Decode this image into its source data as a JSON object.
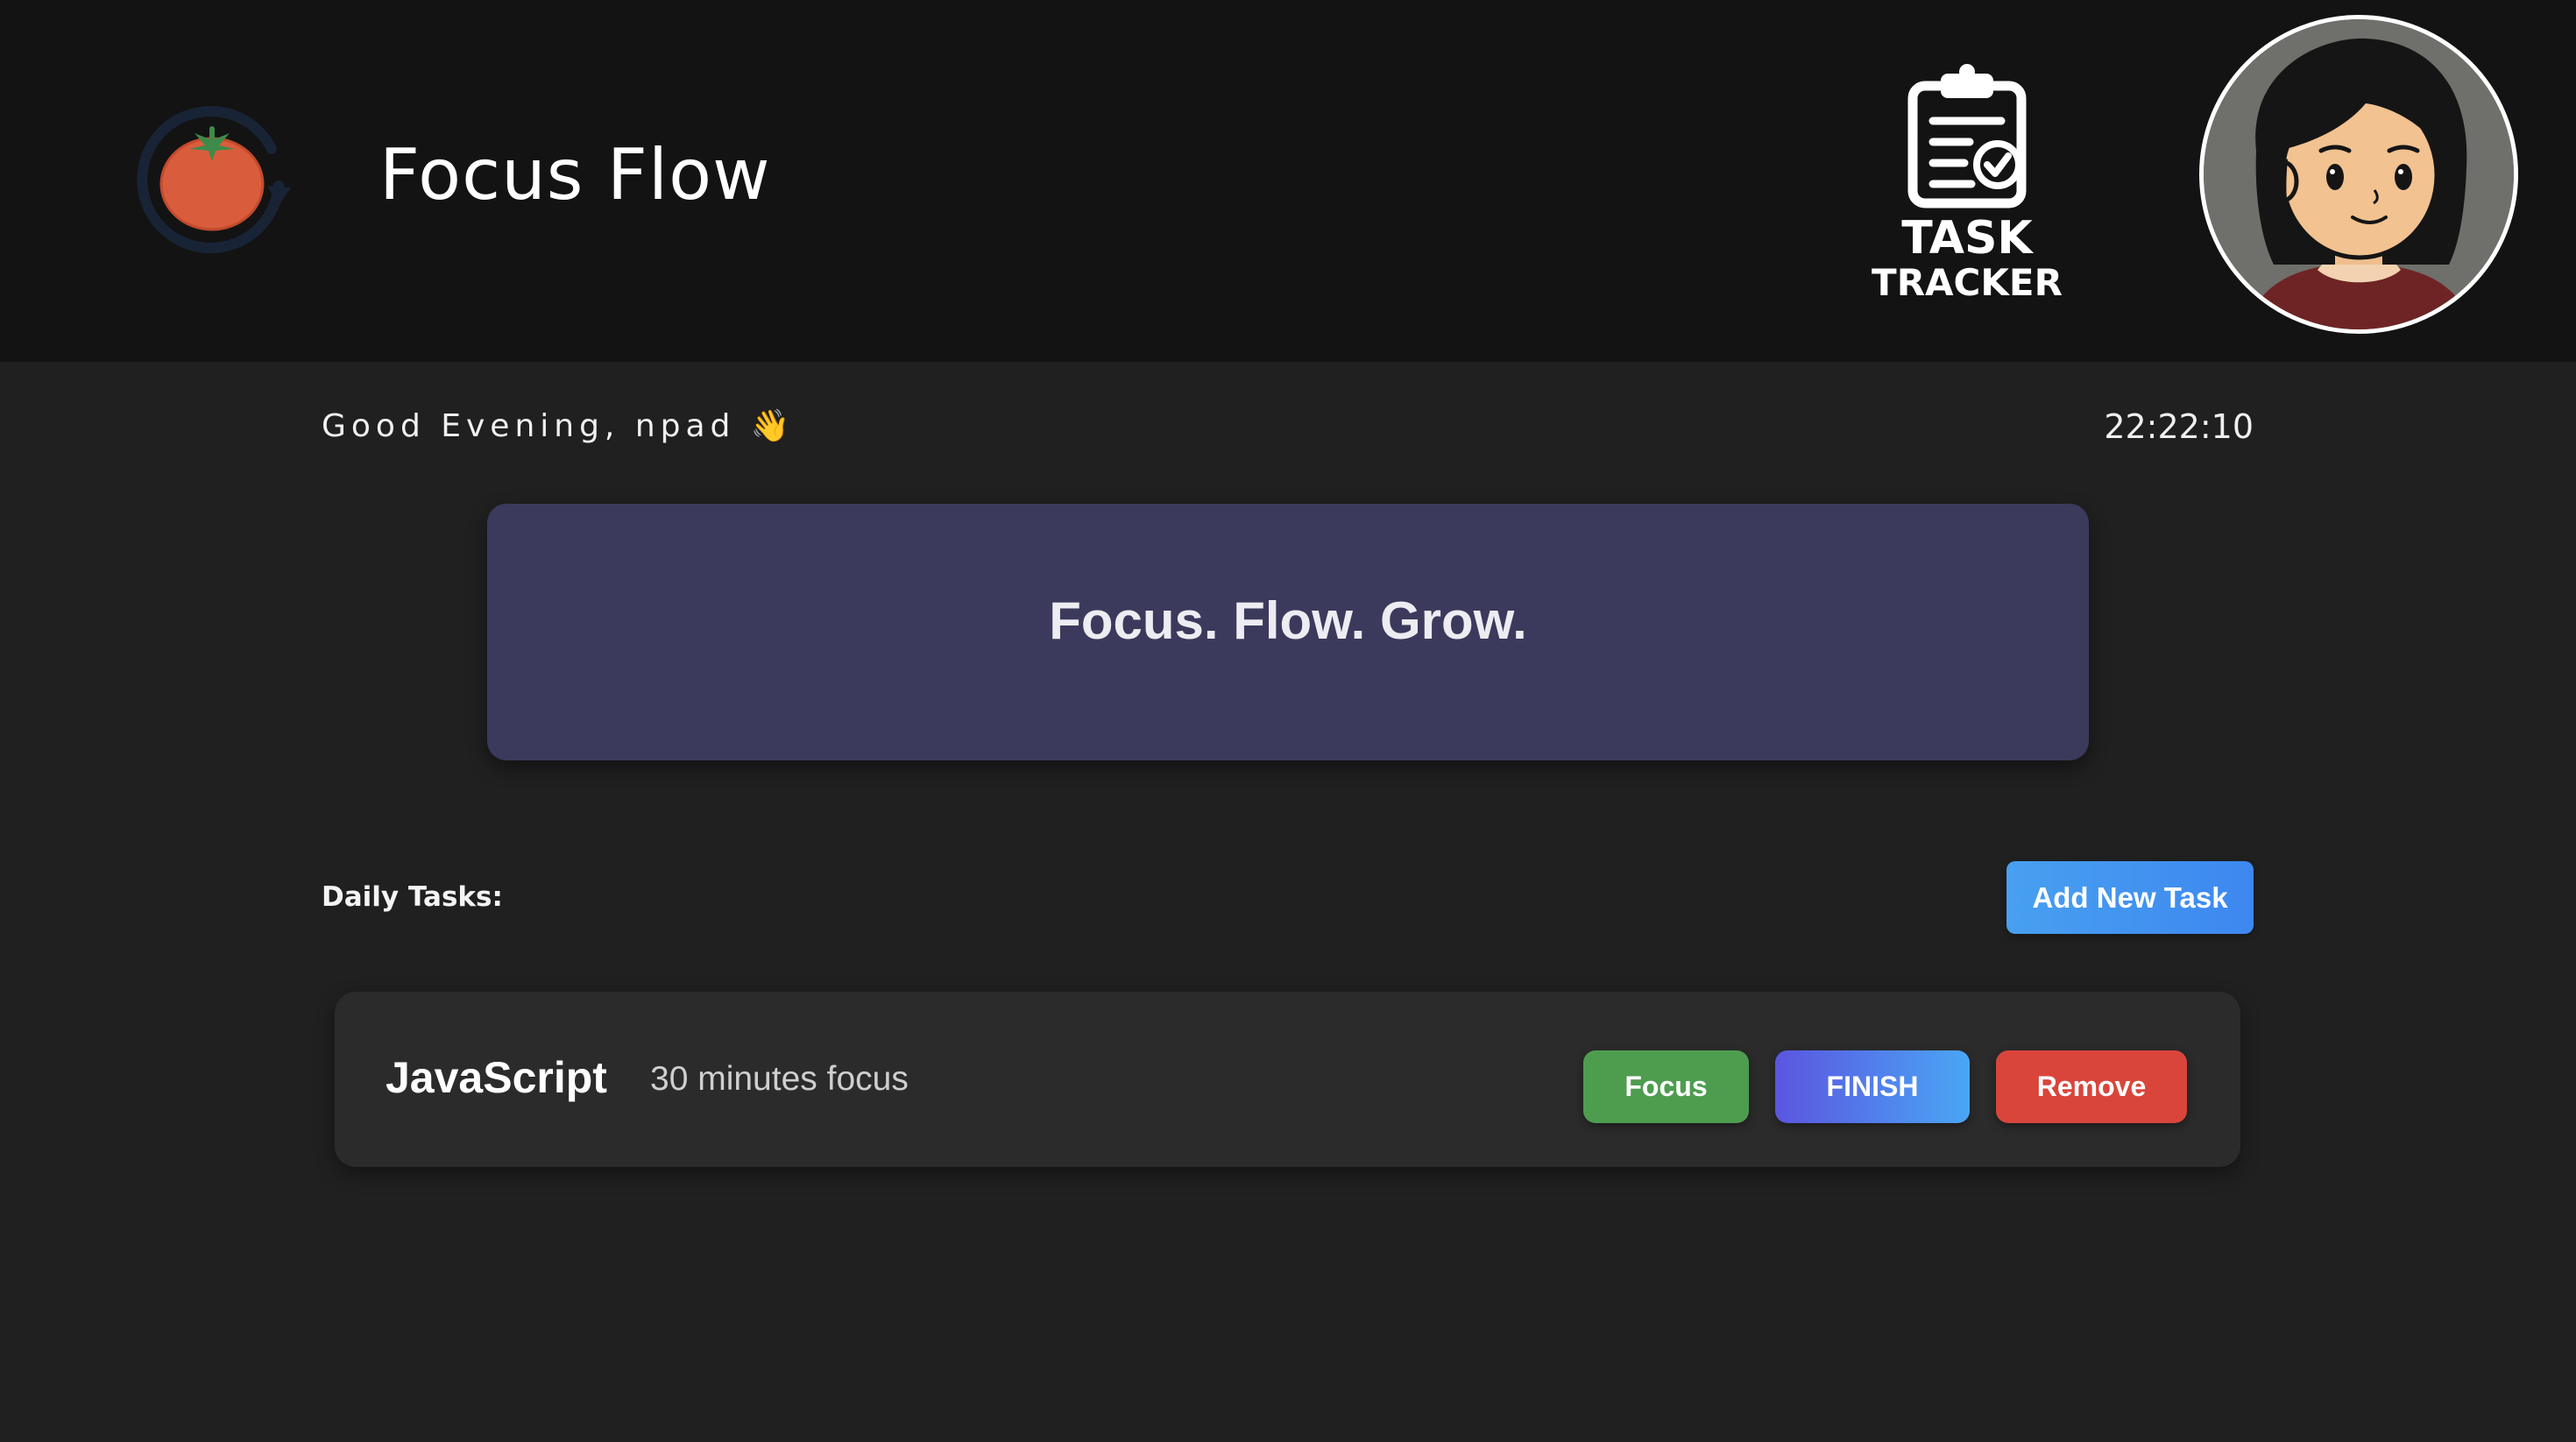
{
  "header": {
    "app_title": "Focus Flow",
    "logo_icon": "tomato-refresh-logo",
    "task_tracker": {
      "line1": "TASK",
      "line2": "TRACKER",
      "icon": "clipboard-check-icon"
    },
    "avatar_icon": "user-avatar"
  },
  "greeting": {
    "text": "Good Evening, npad 👋"
  },
  "clock": {
    "time": "22:22:10"
  },
  "motto": {
    "text": "Focus. Flow. Grow."
  },
  "tasks_section": {
    "label": "Daily Tasks:",
    "add_button": "Add New Task",
    "items": [
      {
        "name": "JavaScript",
        "duration": "30 minutes focus",
        "focus_label": "Focus",
        "finish_label": "FINISH",
        "remove_label": "Remove"
      }
    ]
  },
  "colors": {
    "header_bg": "#131313",
    "page_bg": "#202020",
    "motto_card": "#3b3a5c",
    "task_card": "#2b2b2b",
    "focus": "#4e9d4f",
    "finish_start": "#5b55e0",
    "finish_end": "#4aa6f5",
    "remove": "#d9453b",
    "add_button": "#48a0f0"
  }
}
